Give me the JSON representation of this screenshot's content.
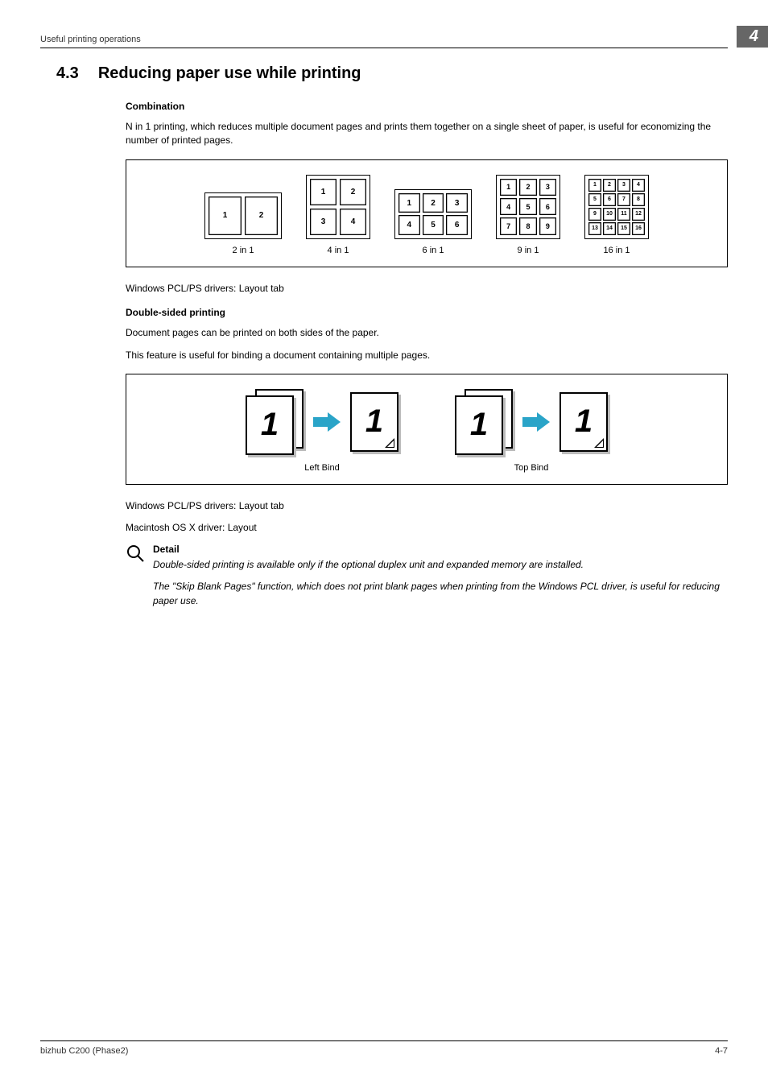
{
  "header": {
    "running": "Useful printing operations",
    "chapter": "4"
  },
  "section": {
    "num": "4.3",
    "title": "Reducing paper use while printing"
  },
  "combination": {
    "heading": "Combination",
    "desc": "N in 1 printing, which reduces multiple document pages and prints them together on a single sheet of paper, is useful for economizing the number of printed pages.",
    "labels": {
      "l2": "2 in 1",
      "l4": "4 in 1",
      "l6": "6 in 1",
      "l9": "9 in 1",
      "l16": "16 in 1"
    },
    "caption_after": "Windows PCL/PS drivers: Layout tab"
  },
  "duplex": {
    "heading": "Double-sided printing",
    "desc1": "Document pages can be printed on both sides of the paper.",
    "desc2": "This feature is useful for binding a document containing multiple pages.",
    "labels": {
      "left": "Left Bind",
      "top": "Top Bind"
    },
    "caption1": "Windows PCL/PS drivers: Layout tab",
    "caption2": "Macintosh OS X driver: Layout"
  },
  "note": {
    "title": "Detail",
    "t1": "Double-sided printing is available only if the optional duplex unit and expanded memory are installed.",
    "t2": "The \"Skip Blank Pages\" function, which does not print blank pages when printing from the Windows PCL driver, is useful for reducing paper use."
  },
  "footer": {
    "left": "bizhub C200 (Phase2)",
    "right": "4-7"
  },
  "nums": {
    "n1": "1",
    "n2": "2",
    "n3": "3",
    "n4": "4",
    "n5": "5",
    "n6": "6",
    "n7": "7",
    "n8": "8",
    "n9": "9",
    "n10": "10",
    "n11": "11",
    "n12": "12",
    "n13": "13",
    "n14": "14",
    "n15": "15",
    "n16": "16"
  }
}
